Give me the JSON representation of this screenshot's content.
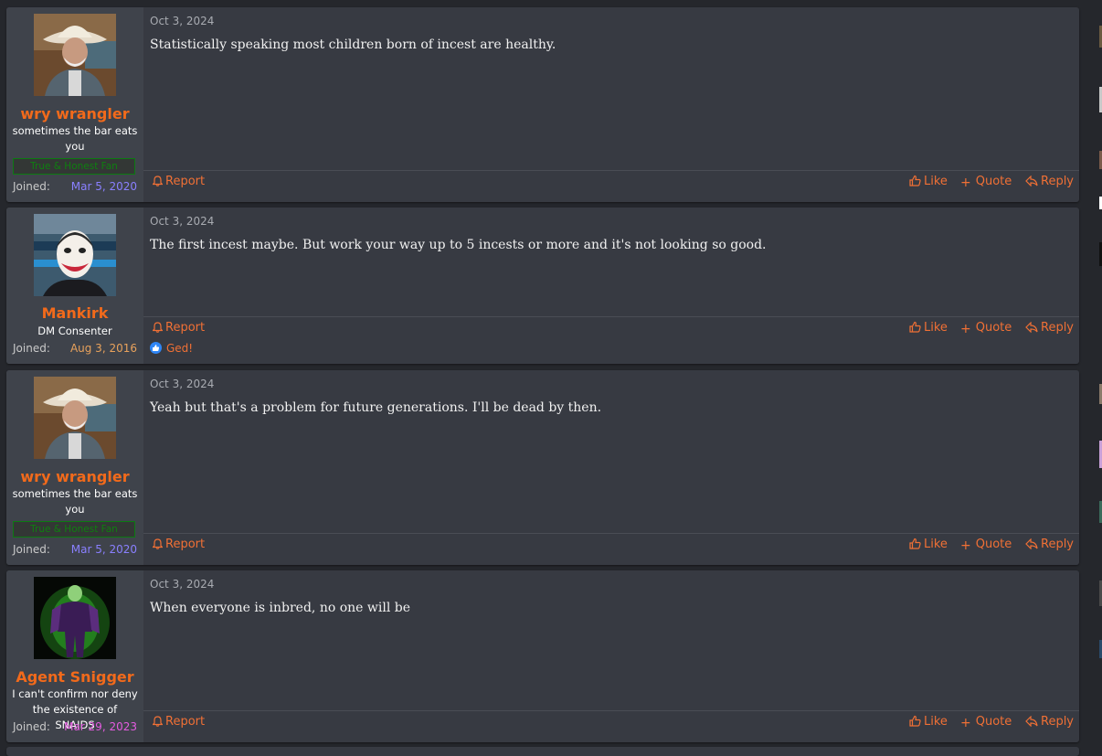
{
  "posts": [
    {
      "username": "wry wrangler",
      "title": "sometimes the bar eats you",
      "banner": "True & Honest Fan",
      "joined_label": "Joined:",
      "joined_date": "Mar 5, 2020",
      "joined_color": "#8a80ff",
      "date": "Oct 3, 2024",
      "message": "Statistically speaking most children born of incest are healthy.",
      "report": "Report",
      "like": "Like",
      "quote": "Quote",
      "reply": "Reply",
      "avatar": "cowboy-avatar"
    },
    {
      "username": "Mankirk",
      "title": "DM Consenter",
      "joined_label": "Joined:",
      "joined_date": "Aug 3, 2016",
      "joined_color": "#e8a25c",
      "date": "Oct 3, 2024",
      "message": "The first incest maybe. But work your way up to 5 incests or more and it's not looking so good.",
      "report": "Report",
      "like": "Like",
      "quote": "Quote",
      "reply": "Reply",
      "reaction_user": "Ged!",
      "avatar": "clown-avatar"
    },
    {
      "username": "wry wrangler",
      "title": "sometimes the bar eats you",
      "banner": "True & Honest Fan",
      "joined_label": "Joined:",
      "joined_date": "Mar 5, 2020",
      "joined_color": "#8a80ff",
      "date": "Oct 3, 2024",
      "message": "Yeah but that's a problem for future generations. I'll be dead by then.",
      "report": "Report",
      "like": "Like",
      "quote": "Quote",
      "reply": "Reply",
      "avatar": "cowboy-avatar"
    },
    {
      "username": "Agent Snigger",
      "title": "I can't confirm nor deny the existence of SNAIDS",
      "joined_label": "Joined:",
      "joined_date": "Mar 29, 2023",
      "joined_color": "#e45ce0",
      "date": "Oct 3, 2024",
      "message": "When everyone is inbred, no one will be",
      "report": "Report",
      "like": "Like",
      "quote": "Quote",
      "reply": "Reply",
      "avatar": "green-figure-avatar"
    }
  ],
  "colors": {
    "accent": "#f26a1b",
    "link": "#f07035",
    "panel": "#373a42",
    "user_panel": "#3f434b",
    "page": "#25272c"
  }
}
